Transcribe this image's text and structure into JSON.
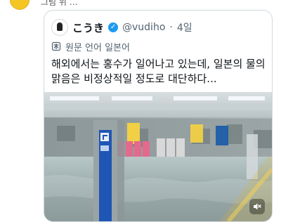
{
  "context": {
    "top_text": "그림 위 …"
  },
  "tweet": {
    "author_name": "こうき",
    "handle": "@vudiho",
    "separator": "·",
    "time": "4일",
    "translation_label": "원문 언어 일본어",
    "text": "해외에서는 홍수가 일어나고 있는데, 일본의 물의 맑음은 비정상적일 정도로 대단하다..."
  },
  "icons": {
    "verified": "verified-badge-icon",
    "translate": "translate-icon",
    "mute": "mute-icon"
  },
  "colors": {
    "accent": "#1d9bf0",
    "border": "#cfd9de",
    "muted_text": "#536471",
    "primary_text": "#0f1419"
  }
}
